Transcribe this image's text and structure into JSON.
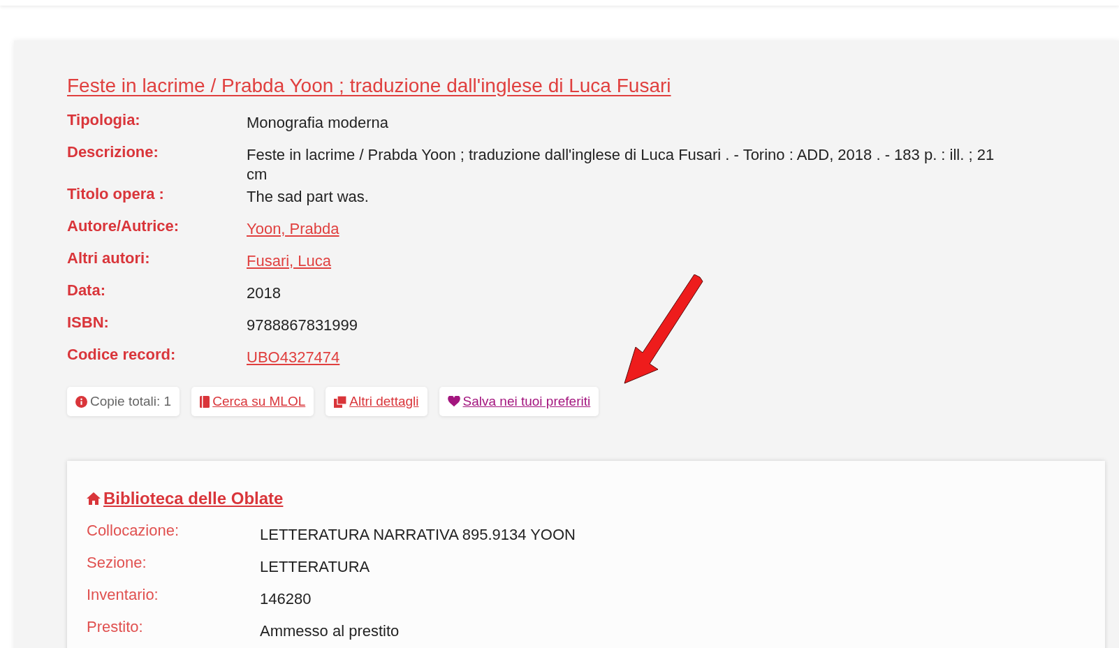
{
  "record": {
    "title": "Feste in lacrime / Prabda Yoon ; traduzione dall'inglese di Luca Fusari",
    "fields": [
      {
        "label": "Tipologia:",
        "value": "Monografia moderna",
        "kind": "text"
      },
      {
        "label": "Descrizione:",
        "value": "Feste in lacrime / Prabda Yoon ; traduzione dall'inglese di Luca Fusari . - Torino : ADD, 2018 . - 183 p. : ill. ; 21 cm",
        "kind": "text"
      },
      {
        "label": "Titolo opera :",
        "value": "The sad part was.",
        "kind": "text"
      },
      {
        "label": "Autore/Autrice:",
        "value": "Yoon, Prabda",
        "kind": "link"
      },
      {
        "label": "Altri autori:",
        "value": "Fusari, Luca",
        "kind": "link"
      },
      {
        "label": "Data:",
        "value": "2018",
        "kind": "text"
      },
      {
        "label": "ISBN:",
        "value": "9788867831999",
        "kind": "text"
      },
      {
        "label": "Codice record:",
        "value": "UBO4327474",
        "kind": "link"
      }
    ],
    "actions": [
      {
        "label": "Copie totali: 1",
        "kind": "info"
      },
      {
        "label": "Cerca su MLOL",
        "kind": "book"
      },
      {
        "label": "Altri dettagli",
        "kind": "details"
      },
      {
        "label": "Salva nei tuoi preferiti",
        "kind": "favorite"
      }
    ]
  },
  "library": {
    "name": "Biblioteca delle Oblate",
    "fields": [
      {
        "label": "Collocazione:",
        "value": "LETTERATURA NARRATIVA 895.9134 YOON"
      },
      {
        "label": "Sezione:",
        "value": "LETTERATURA"
      },
      {
        "label": "Inventario:",
        "value": "146280"
      },
      {
        "label": "Prestito:",
        "value": "Ammesso al prestito"
      }
    ]
  }
}
